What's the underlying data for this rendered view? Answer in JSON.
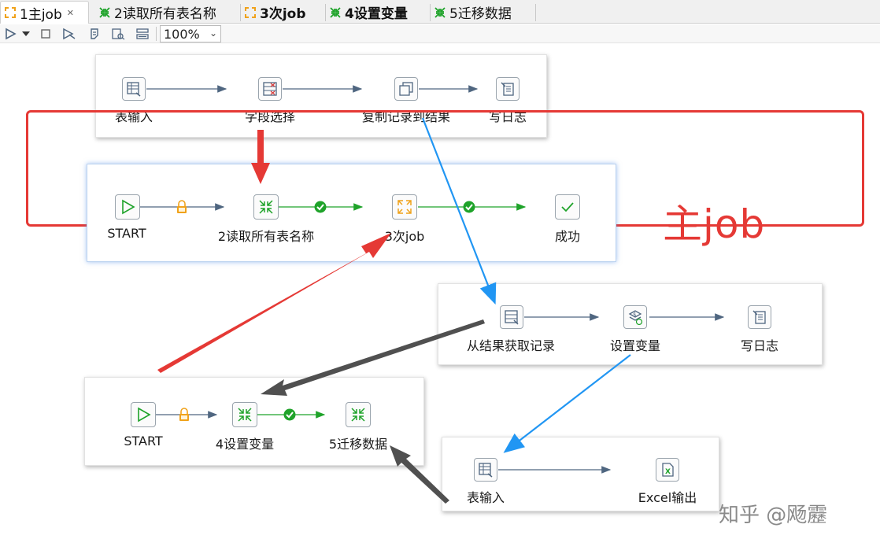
{
  "tabs": [
    {
      "label": "1主job",
      "icon": "job-icon",
      "active": true,
      "closable": true
    },
    {
      "label": "2读取所有表名称",
      "icon": "transform-icon"
    },
    {
      "label": "3次job",
      "icon": "job-icon",
      "bold": true
    },
    {
      "label": "4设置变量",
      "icon": "transform-icon",
      "bold": true
    },
    {
      "label": "5迁移数据",
      "icon": "transform-icon"
    }
  ],
  "toolbar": {
    "zoom": "100%",
    "icons": [
      "run-icon",
      "dropdown-caret-icon",
      "stop-icon",
      "preview-icon",
      "debug-icon",
      "sql-icon",
      "impact-icon"
    ]
  },
  "cards": {
    "top_trans": {
      "nodes": [
        "表输入",
        "字段选择",
        "复制记录到结果",
        "写日志"
      ],
      "icons": [
        "table-input-icon",
        "select-values-icon",
        "copy-rows-icon",
        "write-log-icon"
      ]
    },
    "main_job": {
      "nodes": [
        "START",
        "2读取所有表名称",
        "3次job",
        "成功"
      ],
      "icons": [
        "start-icon",
        "transformation-entry-icon",
        "job-entry-icon",
        "success-icon"
      ],
      "hop_icons": [
        "unconditional-lock-icon",
        "success-check-icon",
        "success-check-icon"
      ]
    },
    "get_rows_trans": {
      "nodes": [
        "从结果获取记录",
        "设置变量",
        "写日志"
      ],
      "icons": [
        "get-rows-icon",
        "set-variables-icon",
        "write-log-icon"
      ]
    },
    "sub_job": {
      "nodes": [
        "START",
        "4设置变量",
        "5迁移数据"
      ],
      "icons": [
        "start-icon",
        "transformation-entry-icon",
        "transformation-entry-icon"
      ],
      "hop_icons": [
        "unconditional-lock-icon",
        "success-check-icon"
      ]
    },
    "excel_trans": {
      "nodes": [
        "表输入",
        "Excel输出"
      ],
      "icons": [
        "table-input-icon",
        "excel-output-icon"
      ]
    }
  },
  "annotation": {
    "title": "主job"
  },
  "watermark": "知乎 @飏靂",
  "colors": {
    "red_arrow": "#e53935",
    "blue_arrow": "#2196f3",
    "gray_arrow": "#505050",
    "hop_blue": "#4f6680",
    "hop_green": "#1fa32a",
    "lock_orange": "#f0a21a",
    "frame_red": "#e53935"
  }
}
